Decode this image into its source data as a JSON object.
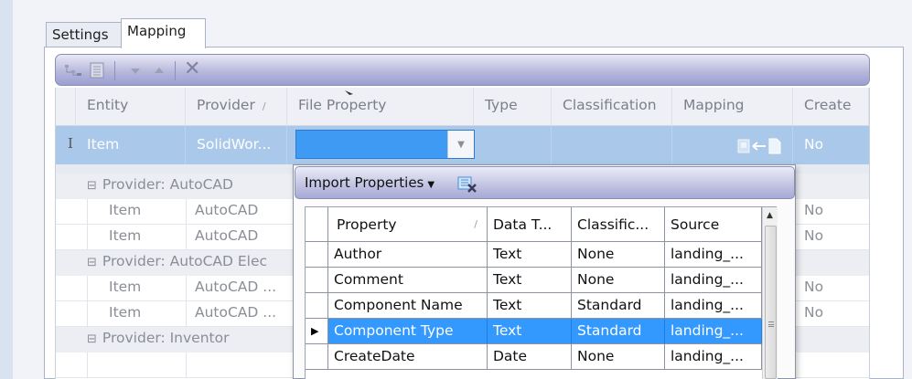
{
  "tabs": [
    {
      "label": "Settings",
      "active": false
    },
    {
      "label": "Mapping",
      "active": true
    }
  ],
  "toolbar": {
    "icons": [
      "tree-view-icon",
      "properties-icon",
      "move-down-icon",
      "move-up-icon",
      "delete-icon"
    ],
    "delete_glyph": "✕"
  },
  "grid": {
    "columns": [
      {
        "label": "Entity",
        "sort": ""
      },
      {
        "label": "Provider",
        "sort": "/"
      },
      {
        "label": "File Property",
        "sort": ""
      },
      {
        "label": "Type",
        "sort": ""
      },
      {
        "label": "Classification",
        "sort": ""
      },
      {
        "label": "Mapping",
        "sort": ""
      },
      {
        "label": "Create",
        "sort": ""
      }
    ],
    "edit_row": {
      "indicator": "I",
      "entity": "Item",
      "provider": "SolidWor...",
      "create": "No"
    },
    "groups": [
      {
        "label": "Provider: AutoCAD",
        "rows": [
          {
            "entity": "Item",
            "provider": "AutoCAD",
            "create": "No"
          },
          {
            "entity": "Item",
            "provider": "AutoCAD",
            "create": "No"
          }
        ]
      },
      {
        "label": "Provider: AutoCAD Elec",
        "rows": [
          {
            "entity": "Item",
            "provider": "AutoCAD ...",
            "create": "No"
          },
          {
            "entity": "Item",
            "provider": "AutoCAD ...",
            "create": "No"
          }
        ]
      },
      {
        "label": "Provider: Inventor",
        "rows": []
      }
    ],
    "expand_glyph": "⊟"
  },
  "popup": {
    "import_label": "Import Properties",
    "columns": [
      {
        "label": "Property",
        "sort": "/"
      },
      {
        "label": "Data T...",
        "sort": ""
      },
      {
        "label": "Classific...",
        "sort": ""
      },
      {
        "label": "Source",
        "sort": ""
      }
    ],
    "rows": [
      {
        "property": "Author",
        "data_type": "Text",
        "classification": "None",
        "source": "landing_..."
      },
      {
        "property": "Comment",
        "data_type": "Text",
        "classification": "None",
        "source": "landing_..."
      },
      {
        "property": "Component Name",
        "data_type": "Text",
        "classification": "Standard",
        "source": "landing_..."
      },
      {
        "property": "Component Type",
        "data_type": "Text",
        "classification": "Standard",
        "source": "landing_...",
        "selected": true
      },
      {
        "property": "CreateDate",
        "data_type": "Date",
        "classification": "None",
        "source": "landing_..."
      }
    ]
  },
  "colors": {
    "accent_selection": "#3399ff",
    "edit_row": "#a9c8ea",
    "toolbar_gradient_end": "#9c9ed0"
  }
}
